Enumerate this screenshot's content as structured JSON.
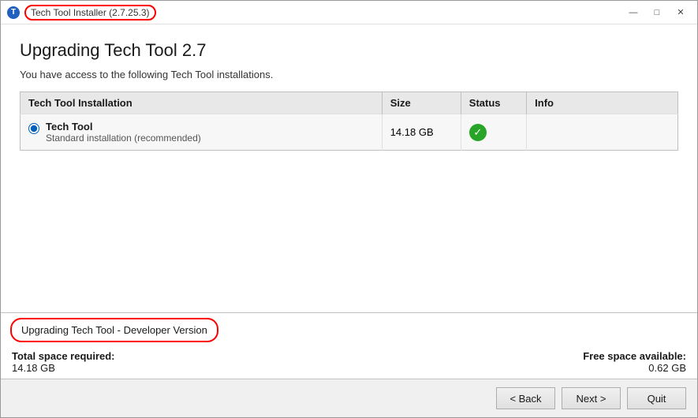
{
  "window": {
    "title": "Tech Tool Installer (2.7.25.3)",
    "controls": {
      "minimize": "—",
      "maximize": "□",
      "close": "✕"
    }
  },
  "page": {
    "heading": "Upgrading Tech Tool 2.7",
    "subtitle": "You have access to the following Tech Tool installations."
  },
  "table": {
    "columns": [
      {
        "id": "installation",
        "label": "Tech Tool Installation"
      },
      {
        "id": "size",
        "label": "Size"
      },
      {
        "id": "status",
        "label": "Status"
      },
      {
        "id": "info",
        "label": "Info"
      }
    ],
    "rows": [
      {
        "name": "Tech Tool",
        "description": "Standard installation (recommended)",
        "size": "14.18 GB",
        "status": "ok",
        "info": ""
      }
    ]
  },
  "footer": {
    "status_text": "Upgrading Tech Tool - Developer Version",
    "total_space_label": "Total space required:",
    "total_space_value": "14.18 GB",
    "free_space_label": "Free space available:",
    "free_space_value": "0.62 GB"
  },
  "buttons": {
    "back": "< Back",
    "next": "Next >",
    "quit": "Quit"
  }
}
